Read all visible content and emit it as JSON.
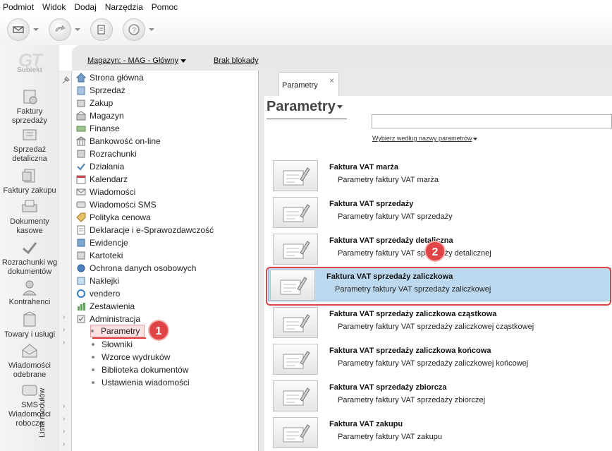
{
  "menu": [
    "Podmiot",
    "Widok",
    "Dodaj",
    "Narzędzia",
    "Pomoc"
  ],
  "toolbar": {
    "buttons": [
      {
        "icon": "envelope-icon",
        "has_dropdown": true
      },
      {
        "icon": "sync-icon",
        "has_dropdown": true
      },
      {
        "icon": "documents-icon",
        "has_dropdown": false
      },
      {
        "icon": "help-icon",
        "has_dropdown": true
      }
    ]
  },
  "logo": {
    "big": "GT",
    "small": "Subiekt"
  },
  "leftbar": [
    {
      "label": "Faktury sprzedaży",
      "icon": "invoice-icon"
    },
    {
      "label": "Sprzedaż detaliczna",
      "icon": "retail-icon"
    },
    {
      "label": "Faktury zakupu",
      "icon": "purchase-invoice-icon"
    },
    {
      "label": "Dokumenty kasowe",
      "icon": "cash-icon"
    },
    {
      "label": "Rozrachunki wg dokumentów",
      "icon": "settlements-icon"
    },
    {
      "label": "Kontrahenci",
      "icon": "contractor-icon"
    },
    {
      "label": "Towary i usługi",
      "icon": "goods-icon"
    },
    {
      "label": "Wiadomości odebrane",
      "icon": "inbox-icon"
    },
    {
      "label": "SMS Wiadomości robocze",
      "icon": "sms-icon"
    }
  ],
  "topstrip": {
    "magazyn": "Magazyn: - MAG - Główny",
    "blokady": "Brak blokady"
  },
  "modules_label": "Lista modułów",
  "tree": [
    "Strona główna",
    "Sprzedaż",
    "Zakup",
    "Magazyn",
    "Finanse",
    "Bankowość on-line",
    "Rozrachunki",
    "Działania",
    "Kalendarz",
    "Wiadomości",
    "Wiadomości SMS",
    "Polityka cenowa",
    "Deklaracje i e-Sprawozdawczość",
    "Ewidencje",
    "Kartoteki",
    "Ochrona danych osobowych",
    "Naklejki",
    "vendero",
    "Zestawienia",
    "Administracja"
  ],
  "tree_sub": [
    "Parametry",
    "Słowniki",
    "Wzorce wydruków",
    "Biblioteka dokumentów",
    "Ustawienia wiadomości"
  ],
  "tab": {
    "label": "Parametry",
    "close": "×"
  },
  "page_title": "Parametry",
  "search": {
    "value": ""
  },
  "choose_label": "Wybierz według nazwy parametrów",
  "params": [
    {
      "title": "Faktura VAT marża",
      "desc": "Parametry faktury VAT marża"
    },
    {
      "title": "Faktura VAT sprzedaży",
      "desc": "Parametry faktury VAT sprzedaży"
    },
    {
      "title": "Faktura VAT sprzedaży detaliczna",
      "desc": "Parametry faktury VAT sprzedaży detalicznej"
    },
    {
      "title": "Faktura VAT sprzedaży zaliczkowa",
      "desc": "Parametry faktury VAT sprzedaży zaliczkowej"
    },
    {
      "title": "Faktura VAT sprzedaży zaliczkowa cząstkowa",
      "desc": "Parametry faktury VAT sprzedaży zaliczkowej cząstkowej"
    },
    {
      "title": "Faktura VAT sprzedaży zaliczkowa końcowa",
      "desc": "Parametry faktury VAT sprzedaży zaliczkowej końcowej"
    },
    {
      "title": "Faktura VAT sprzedaży zbiorcza",
      "desc": "Parametry faktury VAT sprzedaży zbiorczej"
    },
    {
      "title": "Faktura VAT zakupu",
      "desc": "Parametry faktury VAT zakupu"
    }
  ],
  "callouts": [
    "1",
    "2"
  ],
  "colors": {
    "highlight": "#e04444",
    "selected_row": "#bcd9f0"
  }
}
